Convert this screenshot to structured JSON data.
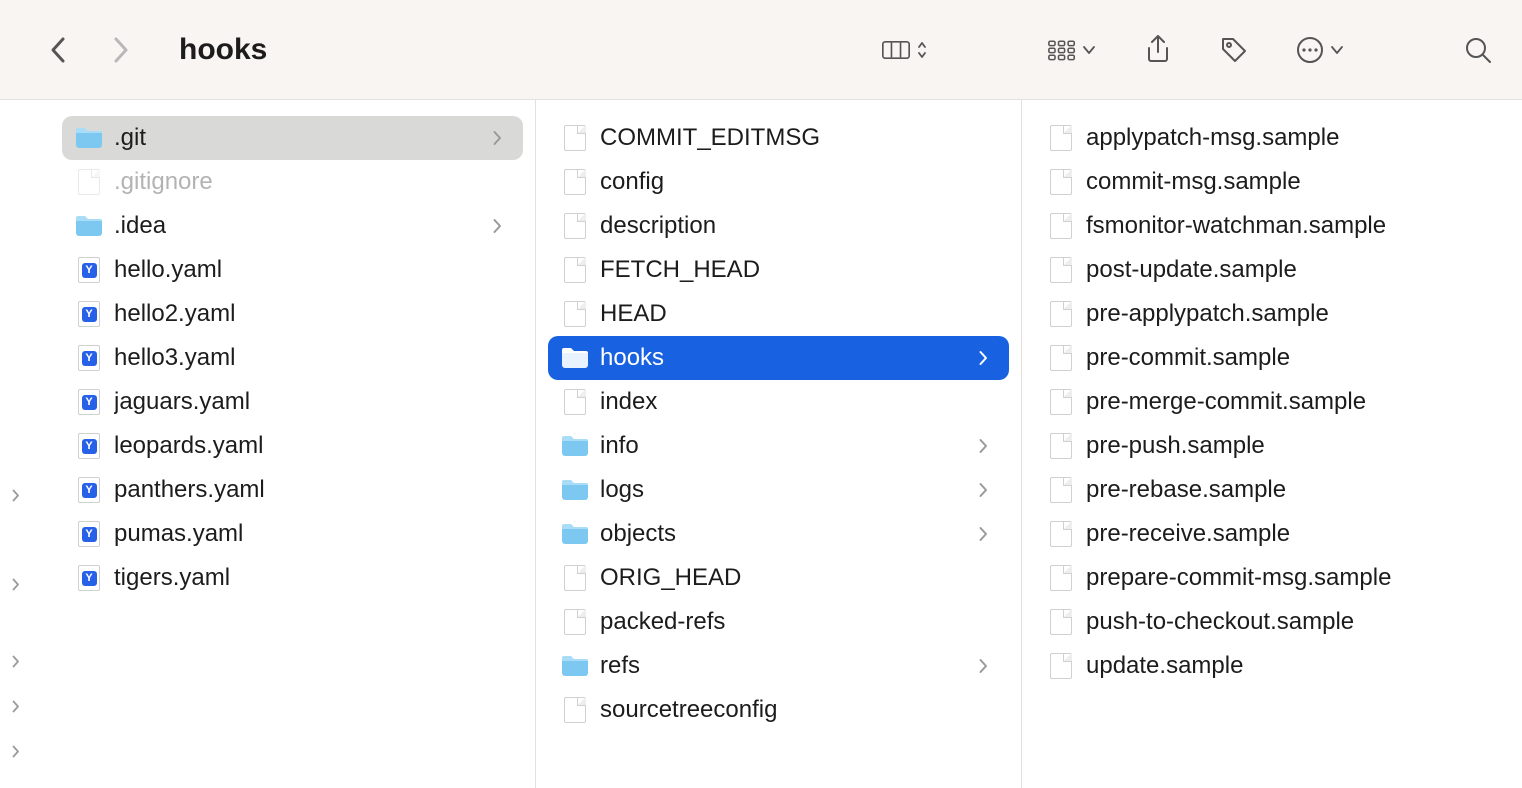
{
  "title": "hooks",
  "columns": [
    {
      "items": [
        {
          "name": ".git",
          "type": "folder",
          "hasChildren": true,
          "state": "selected-parent"
        },
        {
          "name": ".gitignore",
          "type": "file",
          "dim": true
        },
        {
          "name": ".idea",
          "type": "folder",
          "hasChildren": true
        },
        {
          "name": "hello.yaml",
          "type": "yaml"
        },
        {
          "name": "hello2.yaml",
          "type": "yaml"
        },
        {
          "name": "hello3.yaml",
          "type": "yaml"
        },
        {
          "name": "jaguars.yaml",
          "type": "yaml"
        },
        {
          "name": "leopards.yaml",
          "type": "yaml"
        },
        {
          "name": "panthers.yaml",
          "type": "yaml"
        },
        {
          "name": "pumas.yaml",
          "type": "yaml"
        },
        {
          "name": "tigers.yaml",
          "type": "yaml"
        }
      ]
    },
    {
      "items": [
        {
          "name": "COMMIT_EDITMSG",
          "type": "file"
        },
        {
          "name": "config",
          "type": "file"
        },
        {
          "name": "description",
          "type": "file"
        },
        {
          "name": "FETCH_HEAD",
          "type": "file"
        },
        {
          "name": "HEAD",
          "type": "file"
        },
        {
          "name": "hooks",
          "type": "folder",
          "hasChildren": true,
          "state": "selected-active"
        },
        {
          "name": "index",
          "type": "file"
        },
        {
          "name": "info",
          "type": "folder",
          "hasChildren": true
        },
        {
          "name": "logs",
          "type": "folder",
          "hasChildren": true
        },
        {
          "name": "objects",
          "type": "folder",
          "hasChildren": true
        },
        {
          "name": "ORIG_HEAD",
          "type": "file"
        },
        {
          "name": "packed-refs",
          "type": "file"
        },
        {
          "name": "refs",
          "type": "folder",
          "hasChildren": true
        },
        {
          "name": "sourcetreeconfig",
          "type": "file"
        }
      ]
    },
    {
      "items": [
        {
          "name": "applypatch-msg.sample",
          "type": "file"
        },
        {
          "name": "commit-msg.sample",
          "type": "file"
        },
        {
          "name": "fsmonitor-watchman.sample",
          "type": "file"
        },
        {
          "name": "post-update.sample",
          "type": "file"
        },
        {
          "name": "pre-applypatch.sample",
          "type": "file"
        },
        {
          "name": "pre-commit.sample",
          "type": "file"
        },
        {
          "name": "pre-merge-commit.sample",
          "type": "file"
        },
        {
          "name": "pre-push.sample",
          "type": "file"
        },
        {
          "name": "pre-rebase.sample",
          "type": "file"
        },
        {
          "name": "pre-receive.sample",
          "type": "file"
        },
        {
          "name": "prepare-commit-msg.sample",
          "type": "file"
        },
        {
          "name": "push-to-checkout.sample",
          "type": "file"
        },
        {
          "name": "update.sample",
          "type": "file"
        }
      ]
    }
  ],
  "sidebarChevronPositions": [
    489,
    578,
    655,
    700,
    745
  ],
  "colors": {
    "selectionActive": "#1862e1",
    "selectionParent": "#d9d9d7",
    "folder": "#7cc8f0",
    "folderDark": "#4db1ea"
  }
}
